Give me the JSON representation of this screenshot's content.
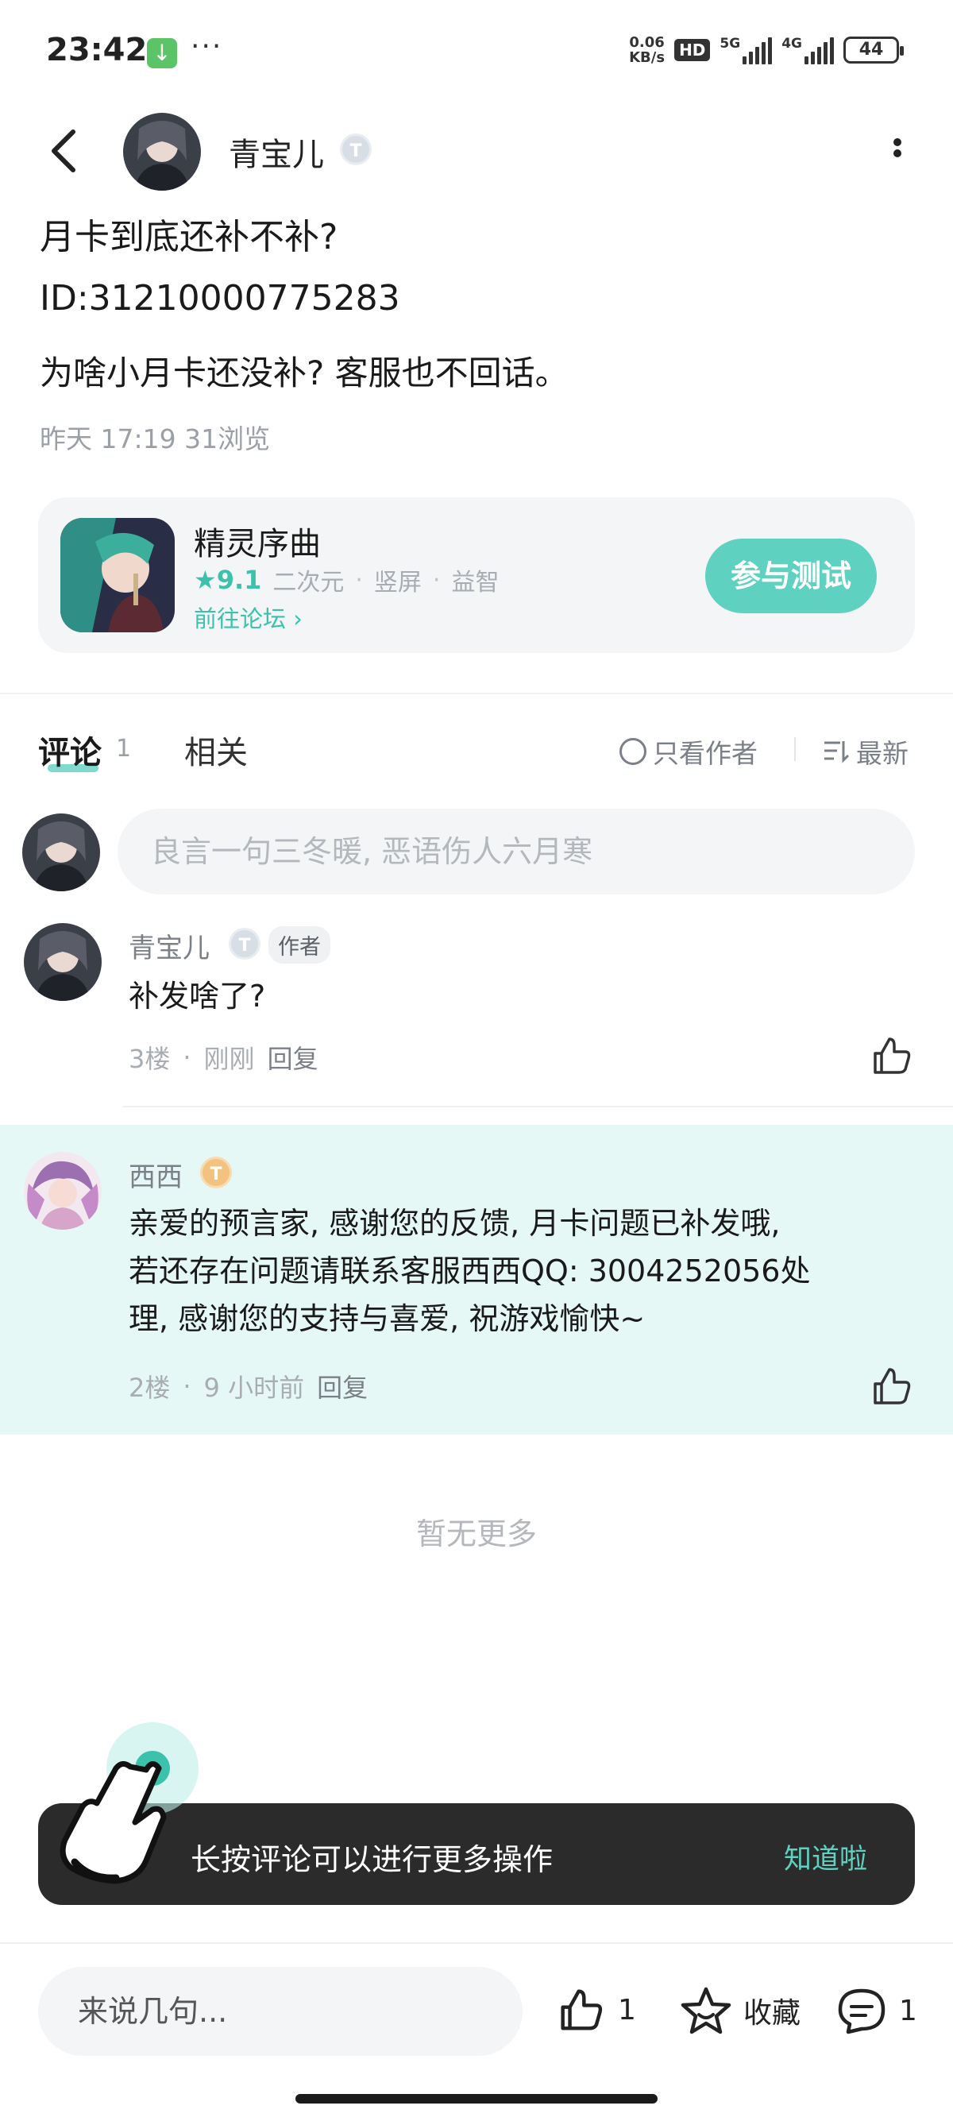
{
  "status_bar": {
    "time": "23:42",
    "speed_value": "0.06",
    "speed_unit": "KB/s",
    "hd": "HD",
    "sig1": "5G",
    "sig2": "4G",
    "battery": "44"
  },
  "header": {
    "author_name": "青宝儿",
    "level_badge": "T"
  },
  "post": {
    "title": "月卡到底还补不补?",
    "id_line": "ID:31210000775283",
    "content": "为啥小月卡还没补? 客服也不回话。",
    "meta": "昨天 17:19  31浏览"
  },
  "game_card": {
    "name": "精灵序曲",
    "score": "9.1",
    "tags": [
      "二次元",
      "竖屏",
      "益智"
    ],
    "forum_link": "前往论坛",
    "join_label": "参与测试"
  },
  "tabs": {
    "comments_label": "评论",
    "comments_count": "1",
    "related_label": "相关",
    "only_author_label": "只看作者",
    "sort_label": "最新"
  },
  "comment_input": {
    "placeholder": "良言一句三冬暖, 恶语伤人六月寒"
  },
  "comments": [
    {
      "name": "青宝儿",
      "badge": "T",
      "author_tag": "作者",
      "text": "补发啥了?",
      "floor": "3楼",
      "time": "刚刚",
      "reply": "回复"
    },
    {
      "name": "西西",
      "badge": "T",
      "text_lines": [
        "亲爱的预言家, 感谢您的反馈, 月卡问题已补发哦,",
        "若还存在问题请联系客服西西QQ: 3004252056处",
        "理, 感谢您的支持与喜爱, 祝游戏愉快~"
      ],
      "floor": "2楼",
      "time": "9 小时前",
      "reply": "回复"
    }
  ],
  "no_more": "暂无更多",
  "toast": {
    "text": "长按评论可以进行更多操作",
    "ack": "知道啦"
  },
  "bottom_bar": {
    "input_placeholder": "来说几句...",
    "like_count": "1",
    "favorite_label": "收藏",
    "comment_count": "1"
  },
  "colors": {
    "accent": "#5fd1c0",
    "highlight_bg": "#e6f8f6",
    "toast_bg": "#2b2b2b"
  }
}
